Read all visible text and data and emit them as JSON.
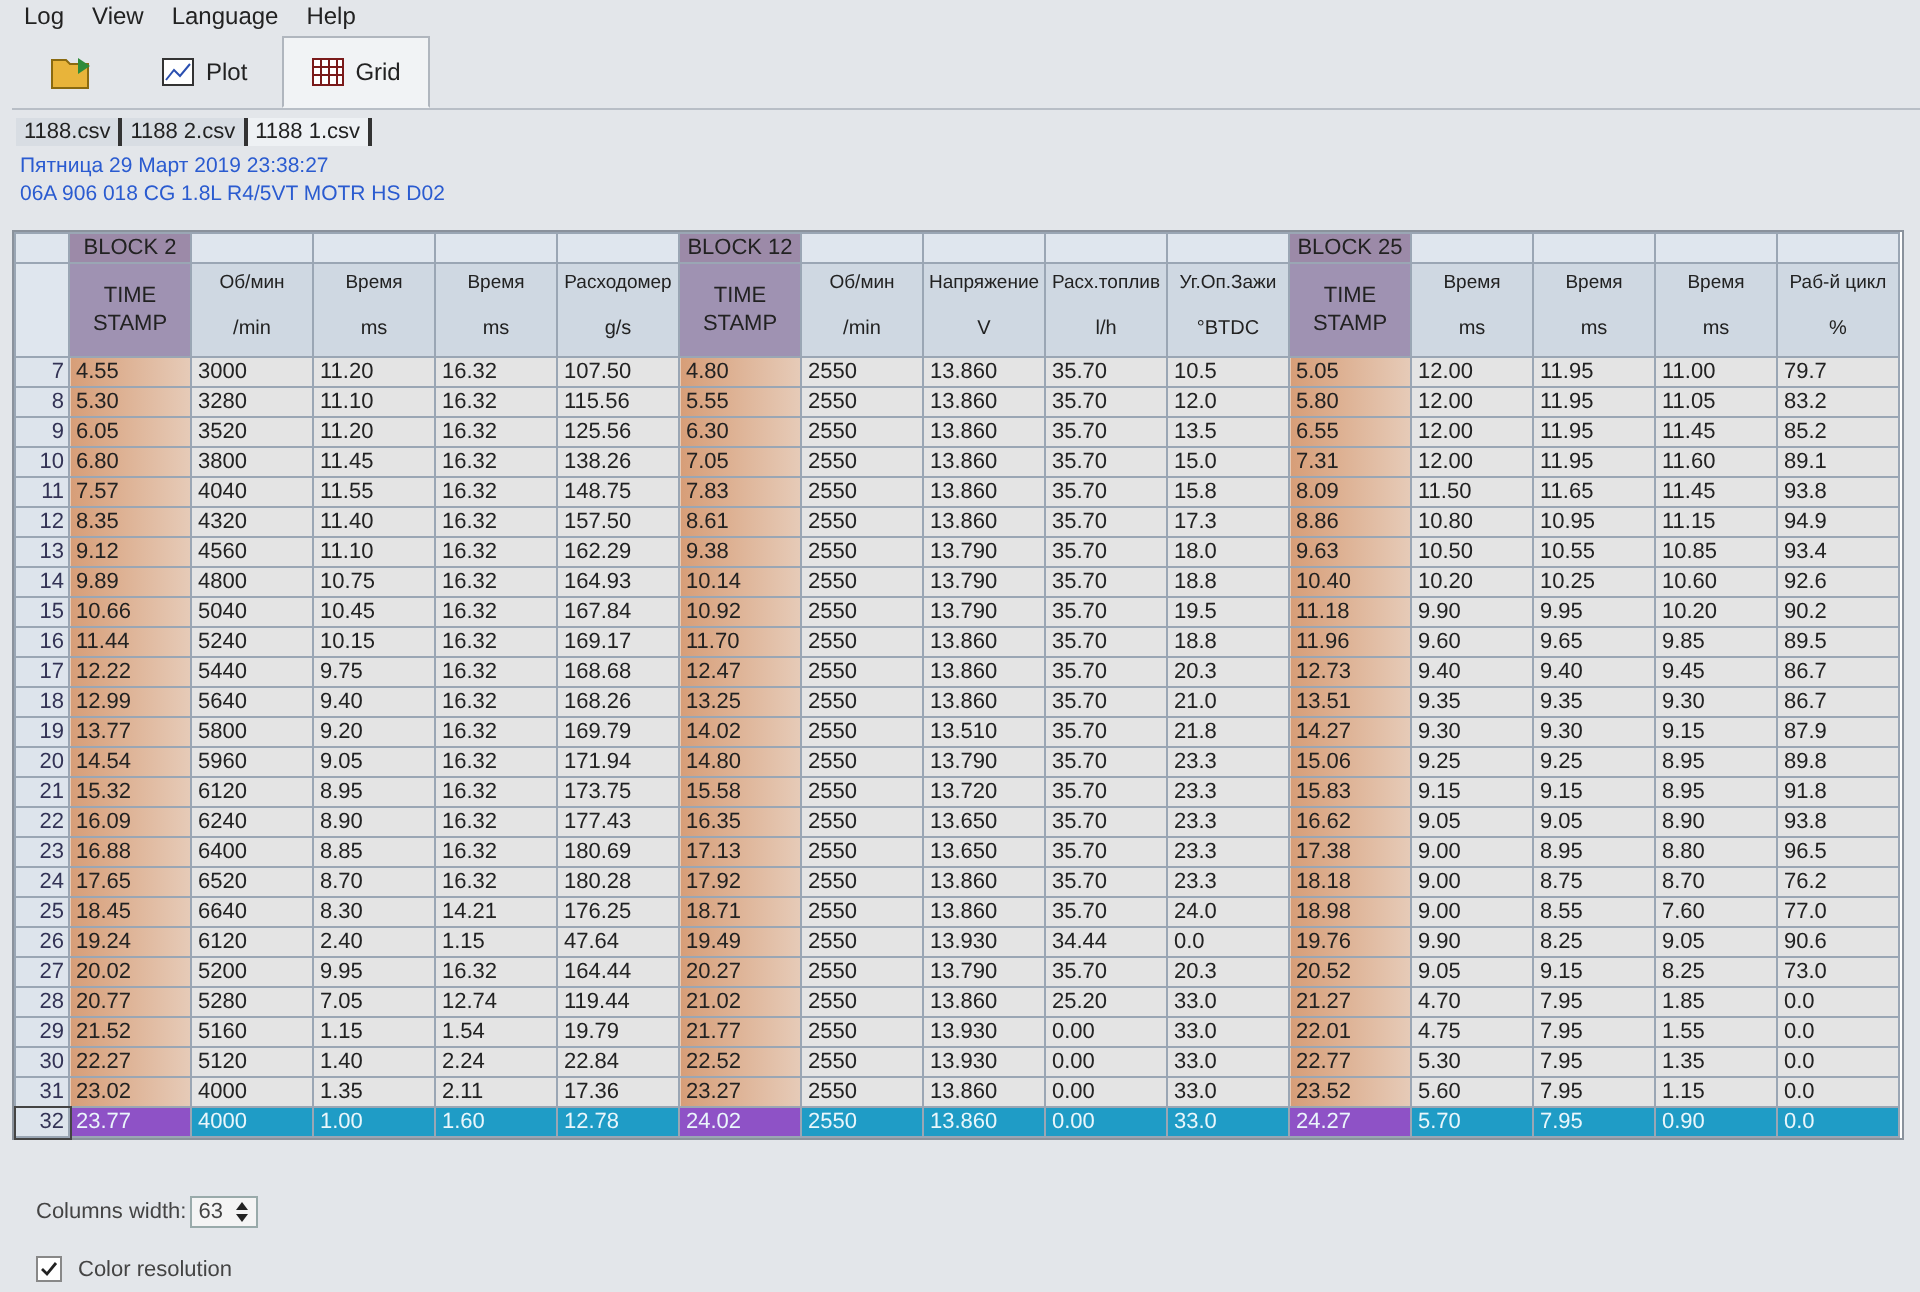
{
  "menu": [
    "Log",
    "View",
    "Language",
    "Help"
  ],
  "toolbar": [
    {
      "kind": "open",
      "selected": false
    },
    {
      "kind": "plot",
      "label": "Plot",
      "selected": false
    },
    {
      "kind": "grid",
      "label": "Grid",
      "selected": true
    }
  ],
  "file_tabs": [
    {
      "label": "1188.csv",
      "selected": false
    },
    {
      "label": "1188 2.csv",
      "selected": false
    },
    {
      "label": "1188 1.csv",
      "selected": true
    }
  ],
  "info": [
    "Пятница 29 Март 2019 23:38:27",
    "06A 906 018 CG  1.8L R4/5VT MOTR HS D02"
  ],
  "columns": [
    {
      "kind": "timestamp",
      "block": "BLOCK 2",
      "name": "TIME STAMP"
    },
    {
      "kind": "value",
      "name": "Об/мин",
      "unit": "/min"
    },
    {
      "kind": "value",
      "name": "Время",
      "unit": "ms"
    },
    {
      "kind": "value",
      "name": "Время",
      "unit": "ms"
    },
    {
      "kind": "value",
      "name": "Расходомер",
      "unit": "g/s"
    },
    {
      "kind": "timestamp",
      "block": "BLOCK 12",
      "name": "TIME STAMP"
    },
    {
      "kind": "value",
      "name": "Об/мин",
      "unit": "/min"
    },
    {
      "kind": "value",
      "name": "Напряжение",
      "unit": "V"
    },
    {
      "kind": "value",
      "name": "Расх.топлив",
      "unit": "l/h"
    },
    {
      "kind": "value",
      "name": "Уг.Оп.Зажи",
      "unit": "°BTDC"
    },
    {
      "kind": "timestamp",
      "block": "BLOCK 25",
      "name": "TIME STAMP"
    },
    {
      "kind": "value",
      "name": "Время",
      "unit": "ms"
    },
    {
      "kind": "value",
      "name": "Время",
      "unit": "ms"
    },
    {
      "kind": "value",
      "name": "Время",
      "unit": "ms"
    },
    {
      "kind": "value",
      "name": "Раб-й цикл",
      "unit": "%"
    }
  ],
  "rows": [
    {
      "num": "7",
      "selected": false,
      "cells": [
        "4.55",
        "3000",
        "11.20",
        "16.32",
        "107.50",
        "4.80",
        "2550",
        "13.860",
        "35.70",
        "10.5",
        "5.05",
        "12.00",
        "11.95",
        "11.00",
        "79.7"
      ]
    },
    {
      "num": "8",
      "selected": false,
      "cells": [
        "5.30",
        "3280",
        "11.10",
        "16.32",
        "115.56",
        "5.55",
        "2550",
        "13.860",
        "35.70",
        "12.0",
        "5.80",
        "12.00",
        "11.95",
        "11.05",
        "83.2"
      ]
    },
    {
      "num": "9",
      "selected": false,
      "cells": [
        "6.05",
        "3520",
        "11.20",
        "16.32",
        "125.56",
        "6.30",
        "2550",
        "13.860",
        "35.70",
        "13.5",
        "6.55",
        "12.00",
        "11.95",
        "11.45",
        "85.2"
      ]
    },
    {
      "num": "10",
      "selected": false,
      "cells": [
        "6.80",
        "3800",
        "11.45",
        "16.32",
        "138.26",
        "7.05",
        "2550",
        "13.860",
        "35.70",
        "15.0",
        "7.31",
        "12.00",
        "11.95",
        "11.60",
        "89.1"
      ]
    },
    {
      "num": "11",
      "selected": false,
      "cells": [
        "7.57",
        "4040",
        "11.55",
        "16.32",
        "148.75",
        "7.83",
        "2550",
        "13.860",
        "35.70",
        "15.8",
        "8.09",
        "11.50",
        "11.65",
        "11.45",
        "93.8"
      ]
    },
    {
      "num": "12",
      "selected": false,
      "cells": [
        "8.35",
        "4320",
        "11.40",
        "16.32",
        "157.50",
        "8.61",
        "2550",
        "13.860",
        "35.70",
        "17.3",
        "8.86",
        "10.80",
        "10.95",
        "11.15",
        "94.9"
      ]
    },
    {
      "num": "13",
      "selected": false,
      "cells": [
        "9.12",
        "4560",
        "11.10",
        "16.32",
        "162.29",
        "9.38",
        "2550",
        "13.790",
        "35.70",
        "18.0",
        "9.63",
        "10.50",
        "10.55",
        "10.85",
        "93.4"
      ]
    },
    {
      "num": "14",
      "selected": false,
      "cells": [
        "9.89",
        "4800",
        "10.75",
        "16.32",
        "164.93",
        "10.14",
        "2550",
        "13.790",
        "35.70",
        "18.8",
        "10.40",
        "10.20",
        "10.25",
        "10.60",
        "92.6"
      ]
    },
    {
      "num": "15",
      "selected": false,
      "cells": [
        "10.66",
        "5040",
        "10.45",
        "16.32",
        "167.84",
        "10.92",
        "2550",
        "13.790",
        "35.70",
        "19.5",
        "11.18",
        "9.90",
        "9.95",
        "10.20",
        "90.2"
      ]
    },
    {
      "num": "16",
      "selected": false,
      "cells": [
        "11.44",
        "5240",
        "10.15",
        "16.32",
        "169.17",
        "11.70",
        "2550",
        "13.860",
        "35.70",
        "18.8",
        "11.96",
        "9.60",
        "9.65",
        "9.85",
        "89.5"
      ]
    },
    {
      "num": "17",
      "selected": false,
      "cells": [
        "12.22",
        "5440",
        "9.75",
        "16.32",
        "168.68",
        "12.47",
        "2550",
        "13.860",
        "35.70",
        "20.3",
        "12.73",
        "9.40",
        "9.40",
        "9.45",
        "86.7"
      ]
    },
    {
      "num": "18",
      "selected": false,
      "cells": [
        "12.99",
        "5640",
        "9.40",
        "16.32",
        "168.26",
        "13.25",
        "2550",
        "13.860",
        "35.70",
        "21.0",
        "13.51",
        "9.35",
        "9.35",
        "9.30",
        "86.7"
      ]
    },
    {
      "num": "19",
      "selected": false,
      "cells": [
        "13.77",
        "5800",
        "9.20",
        "16.32",
        "169.79",
        "14.02",
        "2550",
        "13.510",
        "35.70",
        "21.8",
        "14.27",
        "9.30",
        "9.30",
        "9.15",
        "87.9"
      ]
    },
    {
      "num": "20",
      "selected": false,
      "cells": [
        "14.54",
        "5960",
        "9.05",
        "16.32",
        "171.94",
        "14.80",
        "2550",
        "13.790",
        "35.70",
        "23.3",
        "15.06",
        "9.25",
        "9.25",
        "8.95",
        "89.8"
      ]
    },
    {
      "num": "21",
      "selected": false,
      "cells": [
        "15.32",
        "6120",
        "8.95",
        "16.32",
        "173.75",
        "15.58",
        "2550",
        "13.720",
        "35.70",
        "23.3",
        "15.83",
        "9.15",
        "9.15",
        "8.95",
        "91.8"
      ]
    },
    {
      "num": "22",
      "selected": false,
      "cells": [
        "16.09",
        "6240",
        "8.90",
        "16.32",
        "177.43",
        "16.35",
        "2550",
        "13.650",
        "35.70",
        "23.3",
        "16.62",
        "9.05",
        "9.05",
        "8.90",
        "93.8"
      ]
    },
    {
      "num": "23",
      "selected": false,
      "cells": [
        "16.88",
        "6400",
        "8.85",
        "16.32",
        "180.69",
        "17.13",
        "2550",
        "13.650",
        "35.70",
        "23.3",
        "17.38",
        "9.00",
        "8.95",
        "8.80",
        "96.5"
      ]
    },
    {
      "num": "24",
      "selected": false,
      "cells": [
        "17.65",
        "6520",
        "8.70",
        "16.32",
        "180.28",
        "17.92",
        "2550",
        "13.860",
        "35.70",
        "23.3",
        "18.18",
        "9.00",
        "8.75",
        "8.70",
        "76.2"
      ]
    },
    {
      "num": "25",
      "selected": false,
      "cells": [
        "18.45",
        "6640",
        "8.30",
        "14.21",
        "176.25",
        "18.71",
        "2550",
        "13.860",
        "35.70",
        "24.0",
        "18.98",
        "9.00",
        "8.55",
        "7.60",
        "77.0"
      ]
    },
    {
      "num": "26",
      "selected": false,
      "cells": [
        "19.24",
        "6120",
        "2.40",
        "1.15",
        "47.64",
        "19.49",
        "2550",
        "13.930",
        "34.44",
        "0.0",
        "19.76",
        "9.90",
        "8.25",
        "9.05",
        "90.6"
      ]
    },
    {
      "num": "27",
      "selected": false,
      "cells": [
        "20.02",
        "5200",
        "9.95",
        "16.32",
        "164.44",
        "20.27",
        "2550",
        "13.790",
        "35.70",
        "20.3",
        "20.52",
        "9.05",
        "9.15",
        "8.25",
        "73.0"
      ]
    },
    {
      "num": "28",
      "selected": false,
      "cells": [
        "20.77",
        "5280",
        "7.05",
        "12.74",
        "119.44",
        "21.02",
        "2550",
        "13.860",
        "25.20",
        "33.0",
        "21.27",
        "4.70",
        "7.95",
        "1.85",
        "0.0"
      ]
    },
    {
      "num": "29",
      "selected": false,
      "cells": [
        "21.52",
        "5160",
        "1.15",
        "1.54",
        "19.79",
        "21.77",
        "2550",
        "13.930",
        "0.00",
        "33.0",
        "22.01",
        "4.75",
        "7.95",
        "1.55",
        "0.0"
      ]
    },
    {
      "num": "30",
      "selected": false,
      "cells": [
        "22.27",
        "5120",
        "1.40",
        "2.24",
        "22.84",
        "22.52",
        "2550",
        "13.930",
        "0.00",
        "33.0",
        "22.77",
        "5.30",
        "7.95",
        "1.35",
        "0.0"
      ]
    },
    {
      "num": "31",
      "selected": false,
      "cells": [
        "23.02",
        "4000",
        "1.35",
        "2.11",
        "17.36",
        "23.27",
        "2550",
        "13.860",
        "0.00",
        "33.0",
        "23.52",
        "5.60",
        "7.95",
        "1.15",
        "0.0"
      ]
    },
    {
      "num": "32",
      "selected": true,
      "cells": [
        "23.77",
        "4000",
        "1.00",
        "1.60",
        "12.78",
        "24.02",
        "2550",
        "13.860",
        "0.00",
        "33.0",
        "24.27",
        "5.70",
        "7.95",
        "0.90",
        "0.0"
      ]
    }
  ],
  "columns_width": {
    "label": "Columns width:",
    "value": "63"
  },
  "color_resolution": {
    "label": "Color resolution",
    "checked": true
  }
}
